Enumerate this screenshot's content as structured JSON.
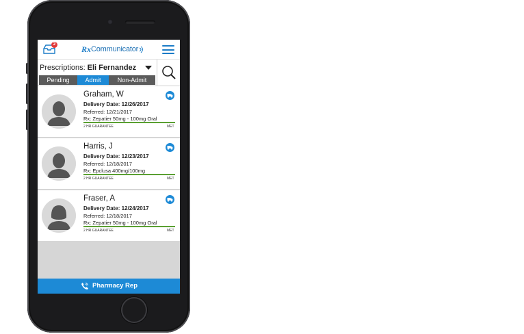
{
  "header": {
    "inbox_badge": "2",
    "logo_rx": "Rx",
    "logo_text": "Communicator"
  },
  "selector": {
    "label": "Prescriptions:",
    "name": "Eli Fernandez"
  },
  "tabs": [
    {
      "label": "Pending",
      "active": false
    },
    {
      "label": "Admit",
      "active": true
    },
    {
      "label": "Non-Admit",
      "active": false
    }
  ],
  "patients": [
    {
      "name": "Graham, W",
      "delivery": "Delivery Date: 12/26/2017",
      "referred": "Referred: 12/21/2017",
      "rx": "Rx: Zepatier 50mg - 100mg Oral",
      "guarantee": "2 HR GUARANTEE",
      "status": "MET",
      "progress": 1.0,
      "gender": "male"
    },
    {
      "name": "Harris, J",
      "delivery": "Delivery Date: 12/23/2017",
      "referred": "Referred: 12/18/2017",
      "rx": "Rx: Epclusa 400mg/100mg",
      "guarantee": "2 HR GUARANTEE",
      "status": "MET",
      "progress": 1.0,
      "gender": "male"
    },
    {
      "name": "Fraser, A",
      "delivery": "Delivery Date: 12/24/2017",
      "referred": "Referred: 12/18/2017",
      "rx": "Rx: Zepatier 50mg - 100mg Oral",
      "guarantee": "2 HR GUARANTEE",
      "status": "MET",
      "progress": 1.0,
      "gender": "female"
    }
  ],
  "footer": {
    "label": "Pharmacy Rep"
  },
  "colors": {
    "accent": "#1d8ad6",
    "tab_inactive": "#5b5b5b",
    "progress": "#5aa032",
    "badge": "#e23b3b"
  },
  "icons": {
    "inbox": "inbox-icon",
    "menu": "hamburger-menu-icon",
    "search": "search-icon",
    "delivery": "delivery-truck-icon",
    "phone": "phone-icon",
    "caret": "chevron-down-icon"
  }
}
